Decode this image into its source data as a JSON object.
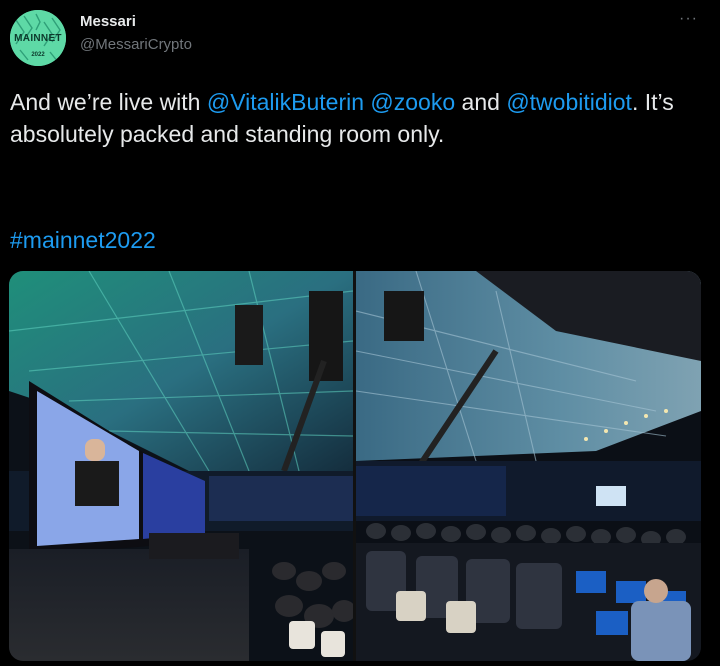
{
  "author": {
    "name": "Messari",
    "handle": "@MessariCrypto",
    "avatar_text": "MAINNET",
    "avatar_year": "2022"
  },
  "tweet": {
    "segments": [
      {
        "text": "And we’re live with ",
        "type": "text"
      },
      {
        "text": "@VitalikButerin",
        "type": "mention"
      },
      {
        "text": " ",
        "type": "text"
      },
      {
        "text": "@zooko",
        "type": "mention"
      },
      {
        "text": " and ",
        "type": "text"
      },
      {
        "text": "@twobitidiot",
        "type": "mention"
      },
      {
        "text": ". It’s absolutely packed and standing room only.",
        "type": "text"
      }
    ],
    "hashtag": "#mainnet2022"
  },
  "menu": {
    "more_label": "···"
  },
  "colors": {
    "background": "#000000",
    "text": "#e7e9ea",
    "secondary": "#71767b",
    "link": "#1d9bf0",
    "avatar": "#5ed9a6"
  },
  "icons": [
    "more-icon"
  ],
  "media": {
    "photo_count": 2
  }
}
